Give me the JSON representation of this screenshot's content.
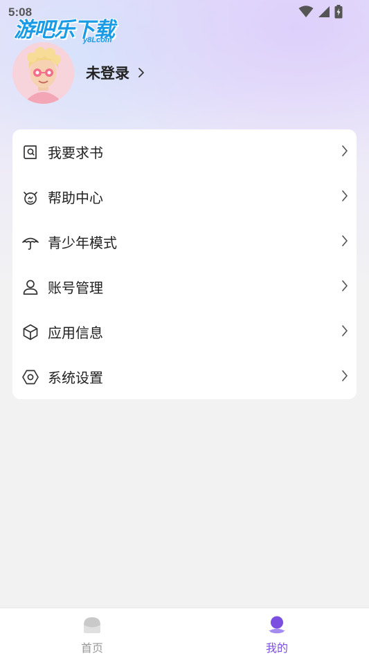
{
  "status_bar": {
    "time": "5:08"
  },
  "watermark": {
    "main": "游吧乐下载",
    "sub": "y8Lcom"
  },
  "profile": {
    "login_text": "未登录"
  },
  "menu": [
    {
      "label": "我要求书",
      "icon": "book-search-icon"
    },
    {
      "label": "帮助中心",
      "icon": "help-robot-icon"
    },
    {
      "label": "青少年模式",
      "icon": "umbrella-icon"
    },
    {
      "label": "账号管理",
      "icon": "user-icon"
    },
    {
      "label": "应用信息",
      "icon": "cube-icon"
    },
    {
      "label": "系统设置",
      "icon": "settings-hexagon-icon"
    }
  ],
  "tabbar": {
    "home_label": "首页",
    "mine_label": "我的",
    "active_color": "#7b4fe0",
    "inactive_color": "#999999"
  }
}
